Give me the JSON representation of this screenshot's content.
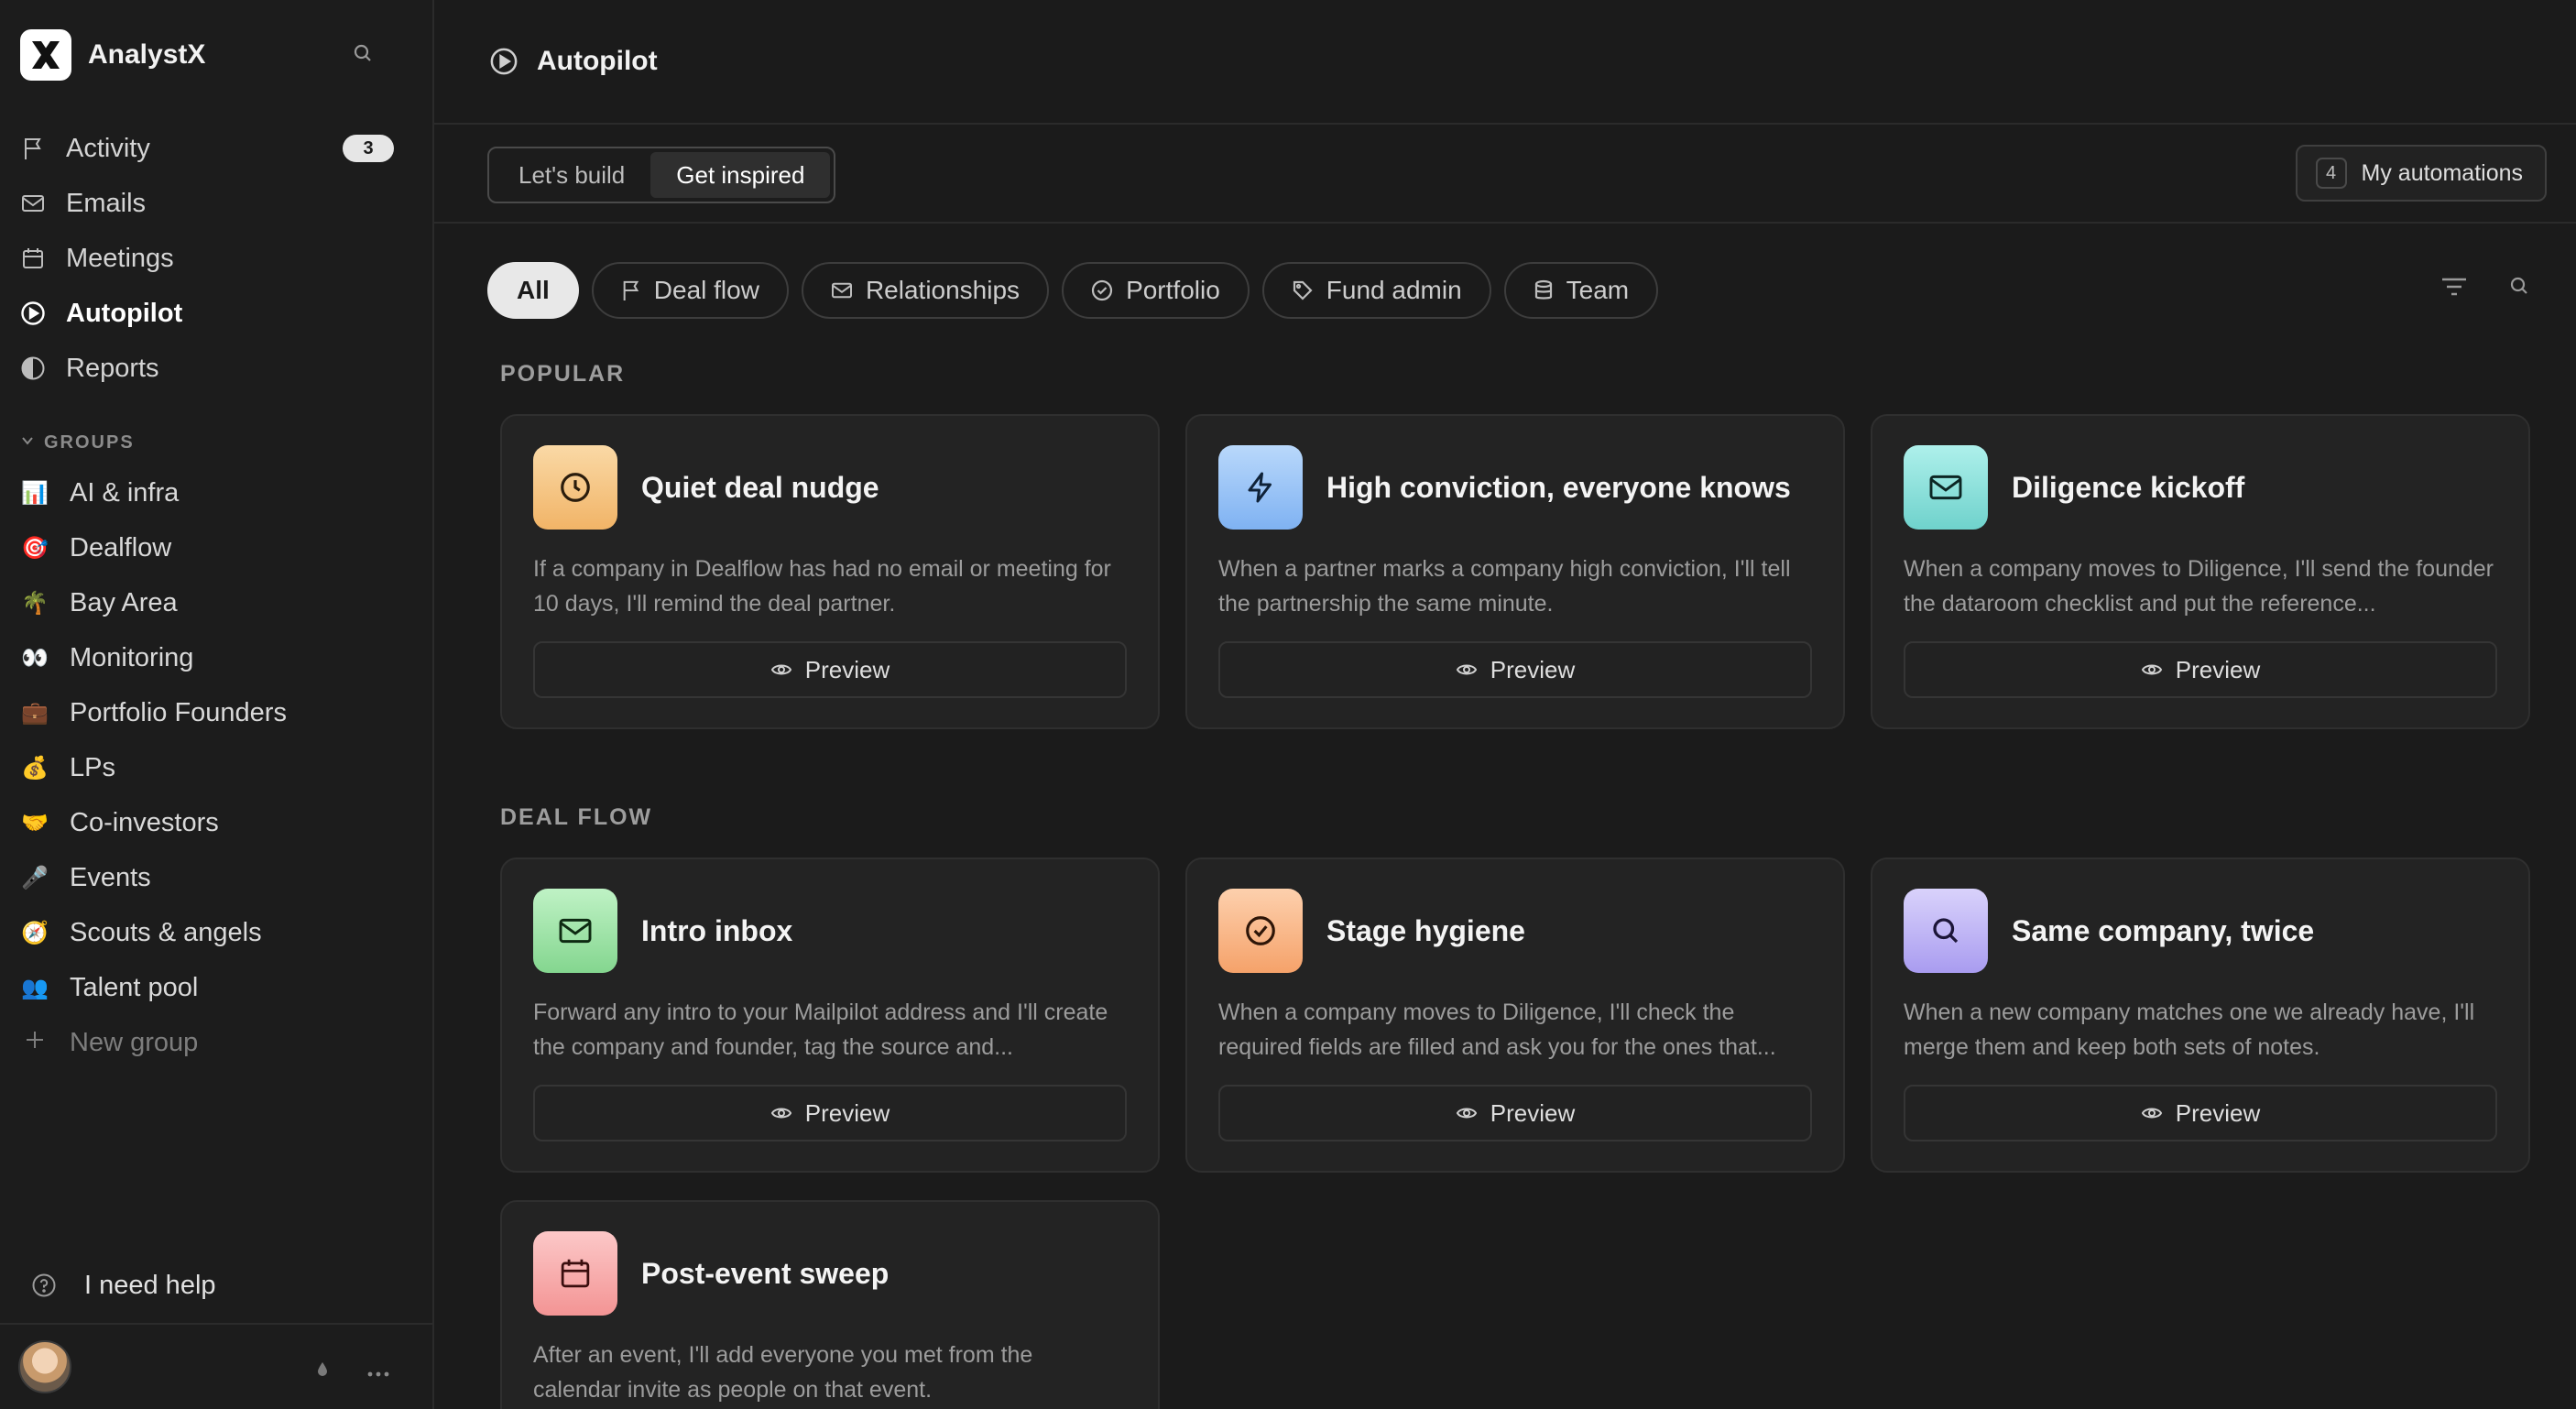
{
  "app": {
    "name": "AnalystX"
  },
  "sidebar": {
    "nav": [
      {
        "label": "Activity",
        "icon": "flag-icon",
        "badge": "3"
      },
      {
        "label": "Emails",
        "icon": "mail-icon"
      },
      {
        "label": "Meetings",
        "icon": "calendar-icon"
      },
      {
        "label": "Autopilot",
        "icon": "play-circle-icon",
        "active": true
      },
      {
        "label": "Reports",
        "icon": "pie-chart-icon"
      }
    ],
    "groups_label": "GROUPS",
    "groups": [
      {
        "emoji": "📊",
        "label": "AI & infra"
      },
      {
        "emoji": "🎯",
        "label": "Dealflow"
      },
      {
        "emoji": "🌴",
        "label": "Bay Area"
      },
      {
        "emoji": "👀",
        "label": "Monitoring"
      },
      {
        "emoji": "💼",
        "label": "Portfolio Founders"
      },
      {
        "emoji": "💰",
        "label": "LPs"
      },
      {
        "emoji": "🤝",
        "label": "Co-investors"
      },
      {
        "emoji": "🎤",
        "label": "Events"
      },
      {
        "emoji": "🧭",
        "label": "Scouts & angels"
      },
      {
        "emoji": "👥",
        "label": "Talent pool"
      }
    ],
    "new_group": "New group",
    "help": "I need help"
  },
  "header": {
    "title": "Autopilot"
  },
  "toolbar": {
    "tabs": [
      "Let's build",
      "Get inspired"
    ],
    "my_automations_count": "4",
    "my_automations_label": "My automations"
  },
  "filters": [
    "All",
    "Deal flow",
    "Relationships",
    "Portfolio",
    "Fund admin",
    "Team"
  ],
  "sections": {
    "popular": "POPULAR",
    "deal_flow": "DEAL FLOW"
  },
  "cards": [
    {
      "title": "Quiet deal nudge",
      "desc": "If a company in Dealflow has had no email or meeting for 10 days, I'll remind the deal partner.",
      "icon": "clock-icon",
      "color": "#f6c98d"
    },
    {
      "title": "High conviction, everyone knows",
      "desc": "When a partner marks a company high conviction, I'll tell the partnership the same minute.",
      "icon": "bolt-icon",
      "color": "#9cc6f7"
    },
    {
      "title": "Diligence kickoff",
      "desc": "When a company moves to Diligence, I'll send the founder the dataroom checklist and put the reference...",
      "icon": "mail-icon",
      "color": "#8fe0dc"
    },
    {
      "title": "Intro inbox",
      "desc": "Forward any intro to your Mailpilot address and I'll create the company and founder, tag the source and...",
      "icon": "mail-icon",
      "color": "#9fe3a8"
    },
    {
      "title": "Stage hygiene",
      "desc": "When a company moves to Diligence, I'll check the required fields are filled and ask you for the ones that...",
      "icon": "check-circle-icon",
      "color": "#f9b98a"
    },
    {
      "title": "Same company, twice",
      "desc": "When a new company matches one we already have, I'll merge them and keep both sets of notes.",
      "icon": "search-icon",
      "color": "#c0b6f5"
    },
    {
      "title": "Post-event sweep",
      "desc": "After an event, I'll add everyone you met from the calendar invite as people on that event.",
      "icon": "calendar-icon",
      "color": "#f8b0b0"
    }
  ],
  "preview_label": "Preview"
}
